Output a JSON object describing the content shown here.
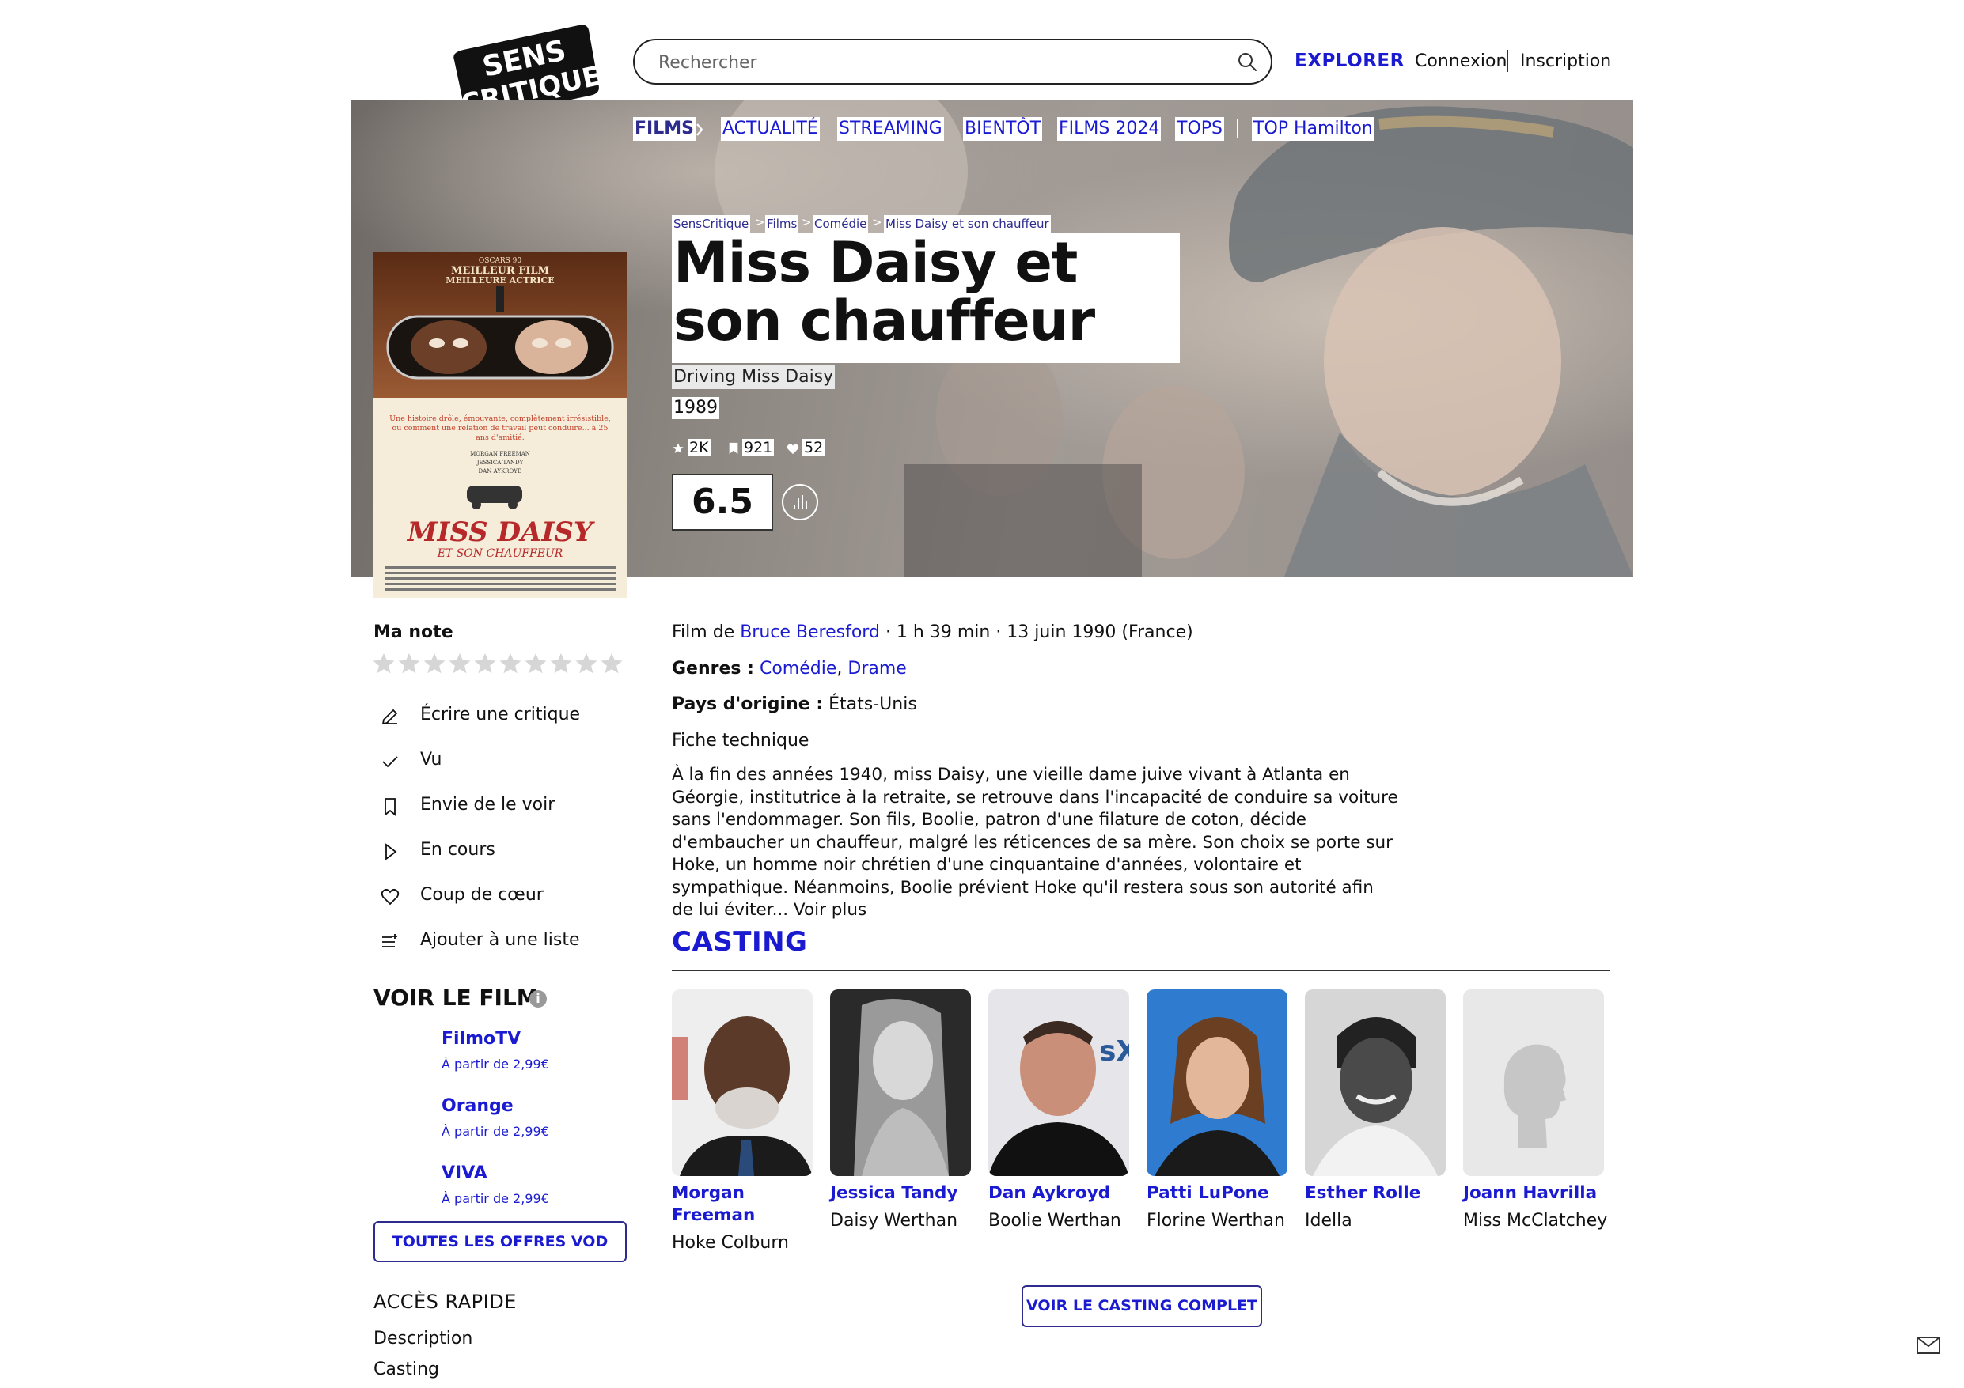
{
  "header": {
    "logo_line1": "SENS",
    "logo_line2": "CRITIQUE",
    "search_placeholder": "Rechercher",
    "explorer": "EXPLORER",
    "login": "Connexion",
    "signup": "Inscription"
  },
  "nav": {
    "items": [
      "FILMS",
      "ACTUALITÉ",
      "STREAMING",
      "BIENTÔT",
      "FILMS 2024",
      "TOPS",
      "TOP Hamilton"
    ]
  },
  "breadcrumb": [
    "SensCritique",
    "Films",
    "Comédie",
    "Miss Daisy et son chauffeur"
  ],
  "film": {
    "title": "Miss Daisy et son chauffeur",
    "original_title": "Driving Miss Daisy",
    "year": "1989",
    "stats": {
      "ratings": "2K",
      "wishlist": "921",
      "favorites": "52"
    },
    "average_rating": "6.5"
  },
  "poster": {
    "award_small": "OSCARS 90",
    "award_line1": "MEILLEUR FILM",
    "award_line2": "MEILLEURE ACTRICE",
    "tagline": "Une histoire drôle, émouvante, complètement irrésistible, ou comment une relation de travail peut conduire... à 25 ans d'amitié.",
    "credits": [
      "MORGAN FREEMAN",
      "JESSICA TANDY",
      "DAN AYKROYD"
    ],
    "logo_main": "MISS DAISY",
    "logo_sub": "ET SON CHAUFFEUR"
  },
  "sidebar": {
    "my_rating_label": "Ma note",
    "star_count": 10,
    "actions": [
      "Écrire une critique",
      "Vu",
      "Envie de le voir",
      "En cours",
      "Coup de cœur",
      "Ajouter à une liste"
    ],
    "watch_title": "VOIR LE FILM",
    "vod": [
      {
        "name": "FilmoTV",
        "price": "À partir de 2,99€"
      },
      {
        "name": "Orange",
        "price": "À partir de 2,99€"
      },
      {
        "name": "VIVA",
        "price": "À partir de 2,99€"
      }
    ],
    "vod_all_button": "TOUTES LES OFFRES VOD",
    "quick_access_title": "ACCÈS RAPIDE",
    "quick_links": [
      "Description",
      "Casting"
    ]
  },
  "details": {
    "film_by_prefix": "Film de",
    "director": "Bruce Beresford",
    "duration_date": "· 1 h 39 min · 13 juin 1990 (France)",
    "genres_label": "Genres :",
    "genres": [
      "Comédie",
      "Drame"
    ],
    "country_label": "Pays d'origine :",
    "country": "États-Unis",
    "tech_sheet": "Fiche technique",
    "synopsis": "À la fin des années 1940, miss Daisy, une vieille dame juive vivant à Atlanta en Géorgie, institutrice à la retraite, se retrouve dans l'incapacité de conduire sa voiture sans l'endommager. Son fils, Boolie, patron d'une filature de coton, décide d'embaucher un chauffeur, malgré les réticences de sa mère. Son choix se porte sur Hoke, un homme noir chrétien d'une cinquantaine d'années, volontaire et sympathique. Néanmoins, Boolie prévient Hoke qu'il restera sous son autorité afin de lui éviter...",
    "read_more": "Voir plus"
  },
  "casting": {
    "title": "CASTING",
    "members": [
      {
        "name": "Morgan Freeman",
        "role": "Hoke Colburn"
      },
      {
        "name": "Jessica Tandy",
        "role": "Daisy Werthan"
      },
      {
        "name": "Dan Aykroyd",
        "role": "Boolie Werthan"
      },
      {
        "name": "Patti LuPone",
        "role": "Florine Werthan"
      },
      {
        "name": "Esther Rolle",
        "role": "Idella"
      },
      {
        "name": "Joann Havrilla",
        "role": "Miss McClatchey"
      }
    ],
    "full_casting_button": "VOIR LE CASTING COMPLET"
  },
  "colors": {
    "accent": "#1a1ad0",
    "nav_active": "#2d2b8e"
  }
}
